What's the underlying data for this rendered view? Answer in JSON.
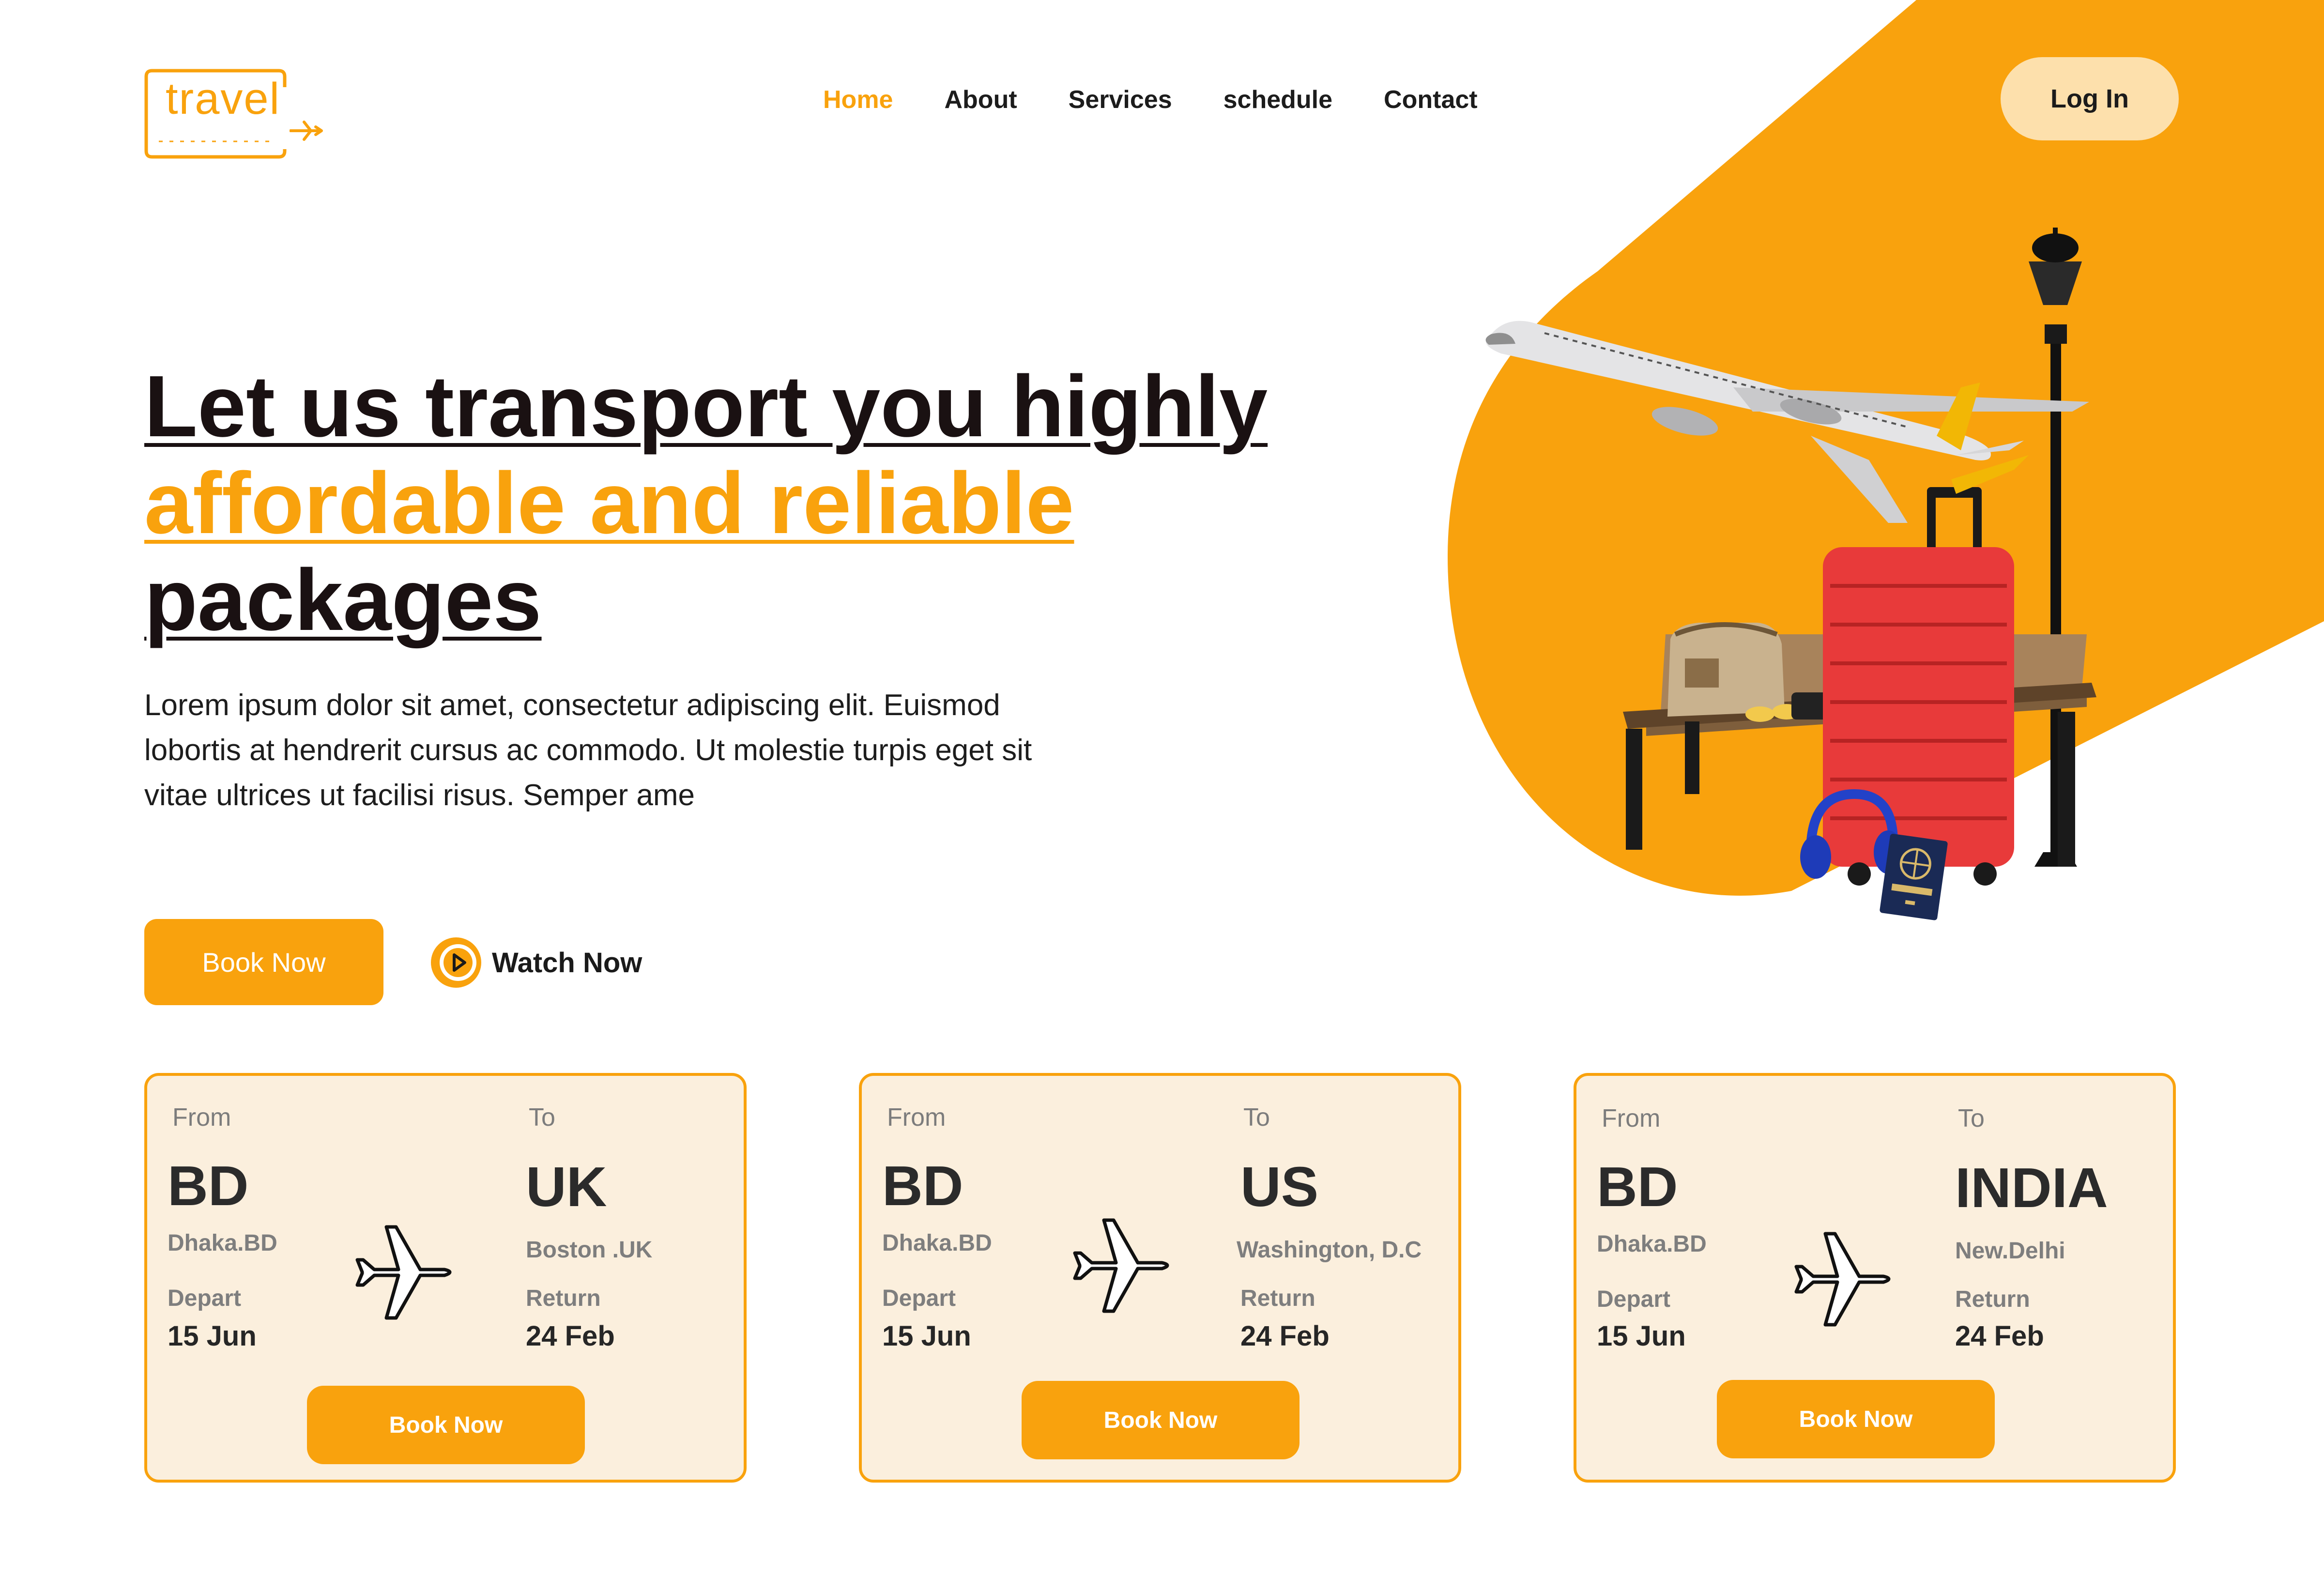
{
  "colors": {
    "accent": "#F9A20D",
    "accent_light": "#FDE0AC",
    "card_bg": "#FBEFDD",
    "suitcase": "#E83A3A"
  },
  "logo": {
    "text": "travel",
    "icon": "airplane-arrow-icon"
  },
  "nav": {
    "items": [
      "Home",
      "About",
      "Services",
      "schedule",
      "Contact"
    ],
    "active": "Home"
  },
  "header": {
    "login_label": "Log In"
  },
  "hero": {
    "headline_line1": "Let us transport you highly",
    "headline_line2": "affordable and reliable",
    "headline_line3": "packages",
    "description": "Lorem ipsum dolor sit amet, consectetur adipiscing elit. Euismod lobortis at hendrerit cursus ac commodo. Ut molestie turpis eget sit vitae ultrices ut facilisi risus. Semper ame",
    "book_label": "Book Now",
    "watch_label": "Watch Now"
  },
  "cards": [
    {
      "from_label": "From",
      "to_label": "To",
      "from_code": "BD",
      "from_city": "Dhaka.BD",
      "to_code": "UK",
      "to_city": "Boston .UK",
      "depart_label": "Depart",
      "depart_date": "15 Jun",
      "return_label": "Return",
      "return_date": "24 Feb",
      "button": "Book Now"
    },
    {
      "from_label": "From",
      "to_label": "To",
      "from_code": "BD",
      "from_city": "Dhaka.BD",
      "to_code": "US",
      "to_city": "Washington, D.C",
      "depart_label": "Depart",
      "depart_date": "15 Jun",
      "return_label": "Return",
      "return_date": "24 Feb",
      "button": "Book Now"
    },
    {
      "from_label": "From",
      "to_label": "To",
      "from_code": "BD",
      "from_city": "Dhaka.BD",
      "to_code": "INDIA",
      "to_city": "New.Delhi",
      "depart_label": "Depart",
      "depart_date": "15 Jun",
      "return_label": "Return",
      "return_date": "24 Feb",
      "button": "Book Now"
    }
  ],
  "illustration": {
    "badge_text": "ПАСПОРТ"
  }
}
